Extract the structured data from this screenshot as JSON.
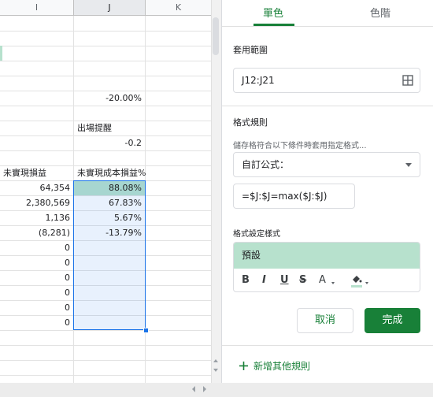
{
  "sheet": {
    "columns": [
      "I",
      "J",
      "K"
    ],
    "selected_column": "J",
    "rows": [
      {
        "i": "",
        "j": "",
        "k": ""
      },
      {
        "i": "",
        "j": "",
        "k": ""
      },
      {
        "i": "",
        "j": "",
        "k": ""
      },
      {
        "i": "",
        "j": "",
        "k": ""
      },
      {
        "i": "",
        "j": "",
        "k": ""
      },
      {
        "i": "",
        "j": "-20.00%",
        "k": ""
      },
      {
        "i": "",
        "j": "",
        "k": ""
      },
      {
        "i": "",
        "j": "出場提醒",
        "k": ""
      },
      {
        "i": "",
        "j": "-0.2",
        "k": ""
      },
      {
        "i": "",
        "j": "",
        "k": ""
      },
      {
        "i": "未實現損益",
        "j": "未實現成本損益%",
        "k": ""
      },
      {
        "i": "64,354",
        "j": "88.08%",
        "k": ""
      },
      {
        "i": "2,380,569",
        "j": "67.83%",
        "k": ""
      },
      {
        "i": "1,136",
        "j": "5.67%",
        "k": ""
      },
      {
        "i": "(8,281)",
        "j": "-13.79%",
        "k": ""
      },
      {
        "i": "0",
        "j": "",
        "k": ""
      },
      {
        "i": "0",
        "j": "",
        "k": ""
      },
      {
        "i": "0",
        "j": "",
        "k": ""
      },
      {
        "i": "0",
        "j": "",
        "k": ""
      },
      {
        "i": "0",
        "j": "",
        "k": ""
      },
      {
        "i": "0",
        "j": "",
        "k": ""
      },
      {
        "i": "",
        "j": "",
        "k": ""
      },
      {
        "i": "",
        "j": "",
        "k": ""
      },
      {
        "i": "",
        "j": "",
        "k": ""
      }
    ]
  },
  "panel": {
    "tabs": [
      "單色",
      "色階"
    ],
    "range_label": "套用範圍",
    "range_value": "J12:J21",
    "rules_label": "格式規則",
    "condition_desc": "儲存格符合以下條件時套用指定格式...",
    "condition_select": "自訂公式：",
    "formula": "=$J:$J=max($J:$J)",
    "style_label": "格式設定樣式",
    "preview_text": "預設",
    "format_buttons": [
      "B",
      "I",
      "U",
      "S",
      "A"
    ],
    "cancel": "取消",
    "done": "完成",
    "add_rule": "新增其他規則"
  },
  "colors": {
    "accent": "#188038",
    "highlight": "#b7e1cd",
    "selection": "#1a73e8"
  }
}
